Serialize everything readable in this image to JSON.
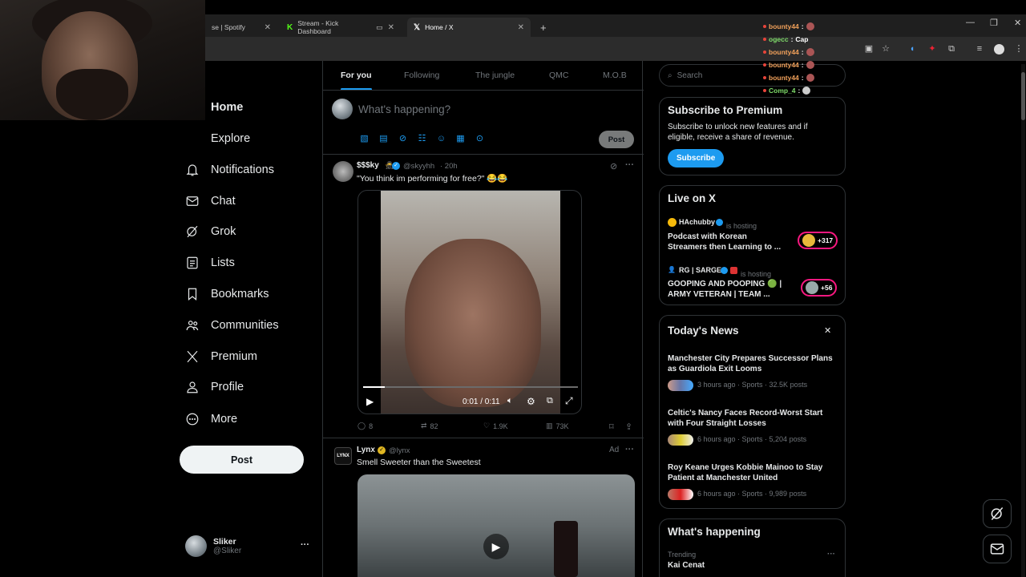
{
  "browser": {
    "tabs": [
      {
        "label": "se | Spotify",
        "icon": "spotify-icon"
      },
      {
        "label": "Stream - Kick Dashboard",
        "icon": "kick-icon"
      },
      {
        "label": "Home / X",
        "icon": "x-logo-icon"
      }
    ],
    "new_tab": "+"
  },
  "chat_overlay": [
    {
      "user": "bounty44",
      "sep": ":",
      "msg": "",
      "color": "#f0a05a"
    },
    {
      "user": "ogecc",
      "sep": ":",
      "msg": "Cap",
      "color": "#7fdc6a"
    },
    {
      "user": "bounty44",
      "sep": ":",
      "msg": "",
      "color": "#f0a05a"
    },
    {
      "user": "bounty44",
      "sep": ":",
      "msg": "",
      "color": "#f0a05a"
    },
    {
      "user": "bounty44",
      "sep": ":",
      "msg": "",
      "color": "#f0a05a"
    },
    {
      "user": "Comp_4",
      "sep": ":",
      "msg": "",
      "color": "#7fdc6a"
    }
  ],
  "sidebar": {
    "items": [
      {
        "label": "Home",
        "icon": "home-icon"
      },
      {
        "label": "Explore",
        "icon": "search-icon"
      },
      {
        "label": "Notifications",
        "icon": "bell-icon"
      },
      {
        "label": "Chat",
        "icon": "mail-icon"
      },
      {
        "label": "Grok",
        "icon": "grok-icon"
      },
      {
        "label": "Lists",
        "icon": "list-icon"
      },
      {
        "label": "Bookmarks",
        "icon": "bookmark-icon"
      },
      {
        "label": "Communities",
        "icon": "people-icon"
      },
      {
        "label": "Premium",
        "icon": "x-logo-icon"
      },
      {
        "label": "Profile",
        "icon": "person-icon"
      },
      {
        "label": "More",
        "icon": "more-circle-icon"
      }
    ],
    "post_label": "Post",
    "user": {
      "name": "Sliker",
      "handle": "@Sliker",
      "menu": "···"
    }
  },
  "feed": {
    "tabs": [
      "For you",
      "Following",
      "The jungle",
      "QMC",
      "M.O.B"
    ],
    "composer_placeholder": "What's happening?",
    "composer_post": "Post",
    "posts": [
      {
        "name": "$$$ky",
        "handle": "@skyyhh",
        "time": "· 20h",
        "text": "\"You think im performing for free?\" 😂😂",
        "video_time": "0:01 / 0:11",
        "replies": "8",
        "reposts": "82",
        "likes": "1.9K",
        "views": "73K"
      },
      {
        "name": "Lynx",
        "handle": "@lynx",
        "ad_label": "Ad",
        "text": "Smell Sweeter than the Sweetest"
      }
    ]
  },
  "right": {
    "search_placeholder": "Search",
    "premium": {
      "title": "Subscribe to Premium",
      "body": "Subscribe to unlock new features and if eligible, receive a share of revenue.",
      "button": "Subscribe"
    },
    "live": {
      "title": "Live on X",
      "items": [
        {
          "host": "HAchubby",
          "status": "is hosting",
          "title": "Podcast with Korean Streamers then Learning to ...",
          "count": "+317"
        },
        {
          "host": "RG | SARGE",
          "status": "is hosting",
          "title": "GOOPING AND POOPING 🟢 | ARMY VETERAN | TEAM ...",
          "count": "+56"
        }
      ]
    },
    "news": {
      "title": "Today's News",
      "close": "✕",
      "items": [
        {
          "title": "Manchester City Prepares Successor Plans as Guardiola Exit Looms",
          "meta": "3 hours ago · Sports · 32.5K posts"
        },
        {
          "title": "Celtic's Nancy Faces Record-Worst Start with Four Straight Losses",
          "meta": "6 hours ago · Sports · 5,204 posts"
        },
        {
          "title": "Roy Keane Urges Kobbie Mainoo to Stay Patient at Manchester United",
          "meta": "6 hours ago · Sports · 9,989 posts"
        }
      ]
    },
    "happening": {
      "title": "What's happening",
      "trend_label": "Trending",
      "trend_name": "Kai Cenat",
      "menu": "···"
    }
  }
}
